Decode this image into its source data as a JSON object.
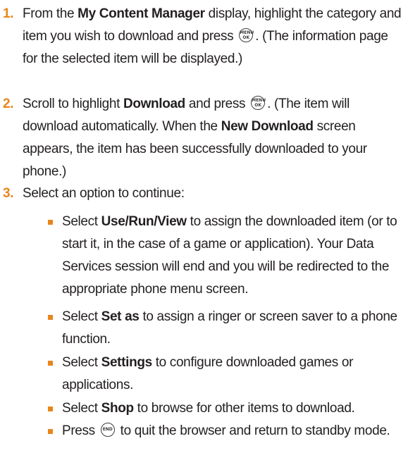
{
  "steps": [
    {
      "number": "1.",
      "parts": [
        {
          "t": "From the "
        },
        {
          "b": "My Content Manager"
        },
        {
          "t": " display, highlight the category and item you wish to download and press "
        },
        {
          "key": "menu-ok"
        },
        {
          "t": ". (The information page for the selected item will be displayed.)"
        }
      ]
    },
    {
      "number": "2.",
      "parts": [
        {
          "t": "Scroll to highlight "
        },
        {
          "b": "Download"
        },
        {
          "t": " and press "
        },
        {
          "key": "menu-ok"
        },
        {
          "t": ". (The item will download automatically. When the "
        },
        {
          "b": "New Download"
        },
        {
          "t": " screen appears, the item has been successfully downloaded to your phone.)"
        }
      ]
    },
    {
      "number": "3.",
      "parts": [
        {
          "t": "Select an option to continue:"
        }
      ]
    }
  ],
  "options": [
    {
      "parts": [
        {
          "t": "Select "
        },
        {
          "b": "Use/Run/View"
        },
        {
          "t": " to assign the downloaded item (or to start it, in the case of a game or application). Your Data Services session will end and you will be redirected to the appropriate phone menu screen."
        }
      ]
    },
    {
      "parts": [
        {
          "t": "Select "
        },
        {
          "b": "Set as"
        },
        {
          "t": " to assign a ringer or screen saver to a phone function."
        }
      ]
    },
    {
      "parts": [
        {
          "t": "Select "
        },
        {
          "b": "Settings"
        },
        {
          "t": " to configure downloaded games or applications."
        }
      ]
    },
    {
      "parts": [
        {
          "t": "Select "
        },
        {
          "b": "Shop"
        },
        {
          "t": " to browse for other items to download."
        }
      ]
    },
    {
      "parts": [
        {
          "t": "Press "
        },
        {
          "key": "end"
        },
        {
          "t": " to quit the browser and return to standby mode."
        }
      ]
    }
  ],
  "keys": {
    "menu-ok": {
      "top": "MENU",
      "bottom": "OK"
    },
    "end": {
      "label": "END"
    }
  },
  "colors": {
    "accent": "#e8861a",
    "text": "#231f20"
  }
}
